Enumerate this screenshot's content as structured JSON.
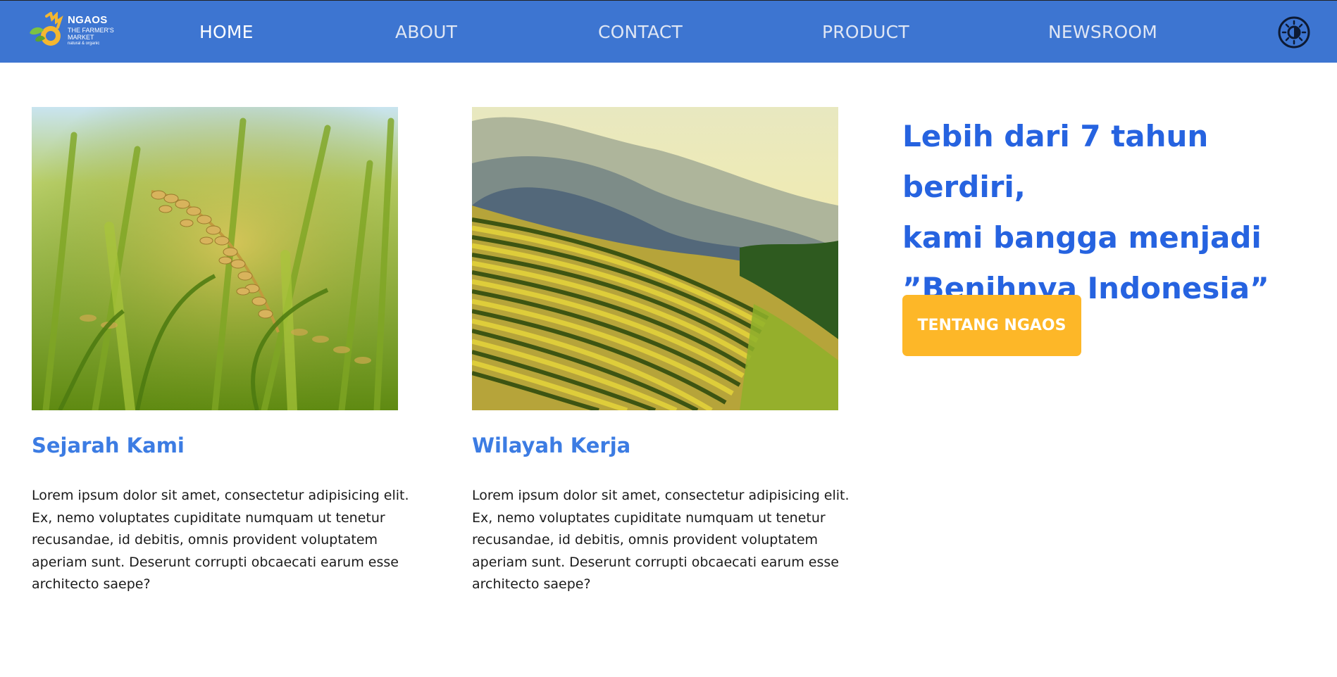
{
  "nav": {
    "logo": {
      "brand": "NGAOS",
      "tagline_line1": "THE FARMER'S",
      "tagline_line2": "MARKET",
      "sub": "natural & organic",
      "icon": "leaf-hand-logo"
    },
    "items": [
      {
        "label": "HOME",
        "active": true
      },
      {
        "label": "ABOUT",
        "active": false
      },
      {
        "label": "CONTACT",
        "active": false
      },
      {
        "label": "PRODUCT",
        "active": false
      },
      {
        "label": "NEWSROOM",
        "active": false
      }
    ],
    "theme_toggle_icon": "sun-moon-icon"
  },
  "cards": [
    {
      "image": "rice-grain-photo",
      "title": "Sejarah Kami",
      "body": "Lorem ipsum dolor sit amet, consectetur adipisicing elit. Ex, nemo voluptates cupiditate numquam ut tenetur recusandae, id debitis, omnis provident voluptatem aperiam sunt. Deserunt corrupti obcaecati earum esse architecto saepe?"
    },
    {
      "image": "rice-terrace-photo",
      "title": "Wilayah Kerja",
      "body": "Lorem ipsum dolor sit amet, consectetur adipisicing elit. Ex, nemo voluptates cupiditate numquam ut tenetur recusandae, id debitis, omnis provident voluptatem aperiam sunt. Deserunt corrupti obcaecati earum esse architecto saepe?"
    }
  ],
  "hero": {
    "line1": "Lebih dari 7 tahun berdiri,",
    "line2": "kami bangga menjadi",
    "line3": "”Benihnya Indonesia”",
    "cta_label": "TENTANG NGAOS"
  },
  "colors": {
    "navbar": "#3d75d1",
    "heading_blue": "#2663e0",
    "card_title_blue": "#3c7ce3",
    "cta_yellow": "#fdb728"
  }
}
